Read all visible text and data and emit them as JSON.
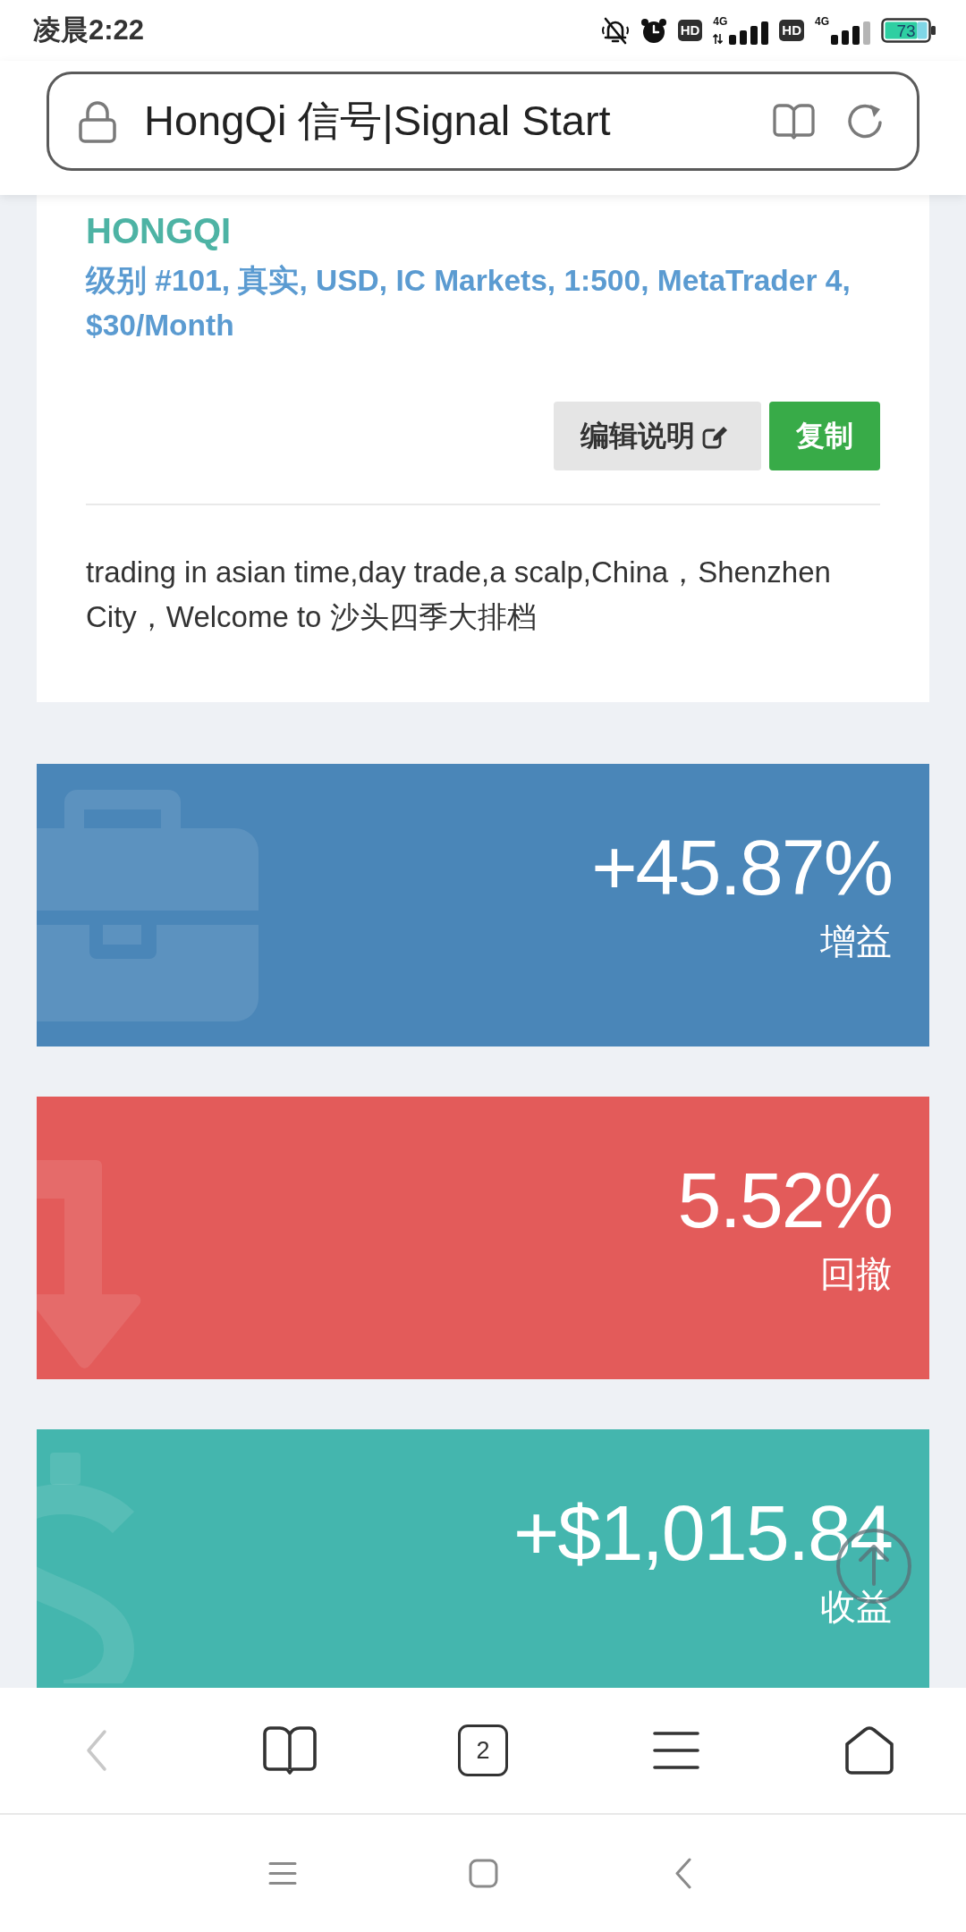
{
  "status_bar": {
    "time": "凌晨2:22",
    "indicators": [
      {
        "kind": "silent"
      },
      {
        "kind": "alarm"
      },
      {
        "kind": "hd",
        "label": "HD"
      },
      {
        "kind": "signal_data",
        "label": "4G"
      },
      {
        "kind": "hd",
        "label": "HD"
      },
      {
        "kind": "signal",
        "label": "4G"
      }
    ],
    "battery": "73"
  },
  "address_bar": {
    "title": "HongQi 信号|Signal Start"
  },
  "signal_card": {
    "name": "HONGQI",
    "details": "级别 #101, 真实, USD, IC Markets, 1:500, MetaTrader 4, $30/Month",
    "buttons": [
      {
        "kind": "edit",
        "label": "编辑说明"
      },
      {
        "kind": "copy",
        "label": "复制"
      }
    ],
    "description": "trading in asian time,day trade,a scalp,China，Shenzhen City，Welcome to 沙头四季大排档"
  },
  "stats": [
    {
      "kind": "gain",
      "value": "+45.87%",
      "label": "增益",
      "color": "#4a86b8"
    },
    {
      "kind": "drawdown",
      "value": "5.52%",
      "label": "回撤",
      "color": "#e35b5a"
    },
    {
      "kind": "profit",
      "value": "+$1,015.84",
      "label": "收益",
      "color": "#44b6ae"
    }
  ],
  "toolbar": [
    {
      "kind": "back",
      "disabled": true
    },
    {
      "kind": "bookmarks",
      "disabled": false
    },
    {
      "kind": "tabs",
      "label": "2",
      "disabled": false
    },
    {
      "kind": "menu",
      "disabled": false
    },
    {
      "kind": "home",
      "disabled": false
    }
  ],
  "system_nav": [
    {
      "kind": "recents"
    },
    {
      "kind": "home"
    },
    {
      "kind": "back"
    }
  ]
}
